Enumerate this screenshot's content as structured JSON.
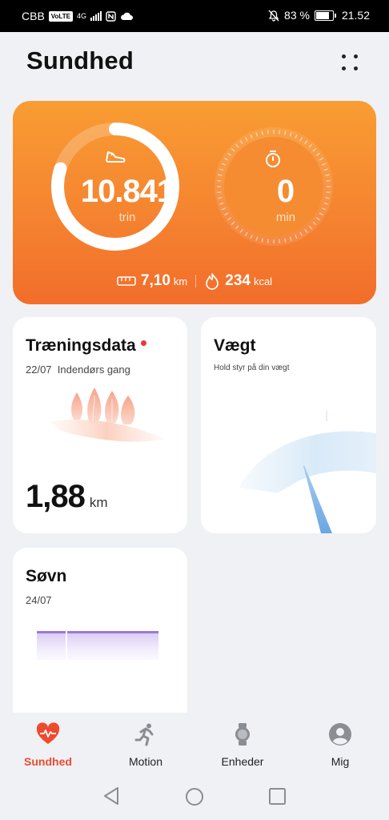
{
  "status_bar": {
    "carrier": "CBB",
    "volte": "VoLTE",
    "network": "4G",
    "battery_percent": "83 %",
    "time": "21.52",
    "icons": [
      "volte-icon",
      "signal-icon",
      "nfc-icon",
      "cloud-icon",
      "mute-icon",
      "battery-icon"
    ]
  },
  "header": {
    "title": "Sundhed",
    "more_icon": "more-dots-icon"
  },
  "activity": {
    "steps_value": "10.841",
    "steps_unit": "trin",
    "steps_progress": 0.8,
    "active_value": "0",
    "active_unit": "min",
    "distance_value": "7,10",
    "distance_unit": "km",
    "calories_value": "234",
    "calories_unit": "kcal",
    "colors": {
      "card_top": "#f99d33",
      "card_bottom": "#f26d2a",
      "ring": "#ffffff"
    }
  },
  "cards": {
    "training": {
      "title": "Træningsdata",
      "date": "22/07",
      "activity": "Indendørs gang",
      "distance_value": "1,88",
      "distance_unit": "km",
      "has_new": true
    },
    "weight": {
      "title": "Vægt",
      "subtitle": "Hold styr på din vægt"
    },
    "sleep": {
      "title": "Søvn",
      "date": "24/07"
    }
  },
  "tabs": [
    {
      "label": "Sundhed",
      "icon": "heart-pulse-icon",
      "active": true
    },
    {
      "label": "Motion",
      "icon": "running-icon",
      "active": false
    },
    {
      "label": "Enheder",
      "icon": "watch-icon",
      "active": false
    },
    {
      "label": "Mig",
      "icon": "profile-icon",
      "active": false
    }
  ],
  "nav": {
    "icons": [
      "back-icon",
      "home-icon",
      "recents-icon"
    ]
  },
  "accent_color": "#ef4a2f"
}
